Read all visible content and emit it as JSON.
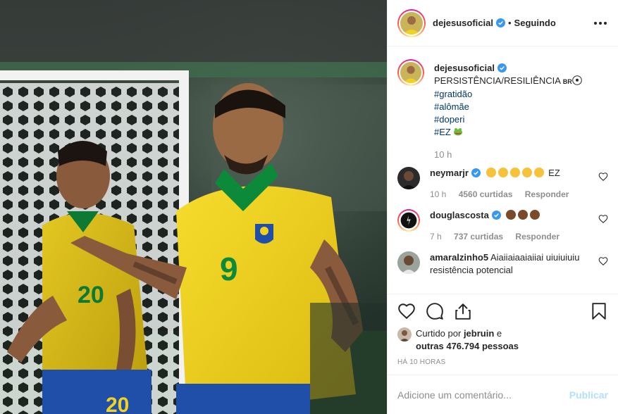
{
  "post": {
    "photo_alt": "",
    "author": {
      "username": "dejesusoficial",
      "follow_state": "Seguindo",
      "separator": "•"
    },
    "caption": {
      "username": "dejesusoficial",
      "text": "PERSISTÊNCIA/RESILIÊNCIA",
      "flag_text": "BR",
      "hashtags": [
        "#gratidão",
        "#alômãe",
        "#doperi",
        "#EZ"
      ],
      "time": "10 h"
    },
    "comments": [
      {
        "username": "neymarjr",
        "text": "EZ",
        "emoji_count": 5,
        "time": "10 h",
        "likes": "4560 curtidas",
        "reply": "Responder"
      },
      {
        "username": "douglascosta",
        "text": "",
        "emoji_count": 3,
        "time": "7 h",
        "likes": "737 curtidas",
        "reply": "Responder"
      },
      {
        "username": "amaralzinho5",
        "text": "Aiaiiaiaaiaiiai uiuiuiuiu resistência potencial"
      }
    ],
    "liked_by": {
      "prefix": "Curtido por",
      "user": "jebruin",
      "conjunction": "e",
      "others": "outras 476.794 pessoas"
    },
    "posted_ago": "HÁ 10 HORAS",
    "add_comment": {
      "placeholder": "Adicione um comentário...",
      "publish_label": "Publicar"
    }
  },
  "colors": {
    "link": "#00376b",
    "muted": "#8e8e8e",
    "verified": "#3897f0",
    "publish_disabled": "#b2dffc",
    "jersey_yellow": "#f2d21e",
    "jersey_green": "#0c8a3a"
  },
  "icons": [
    "verified-icon",
    "more-options-icon",
    "heart-icon",
    "comment-icon",
    "share-icon",
    "bookmark-icon"
  ]
}
